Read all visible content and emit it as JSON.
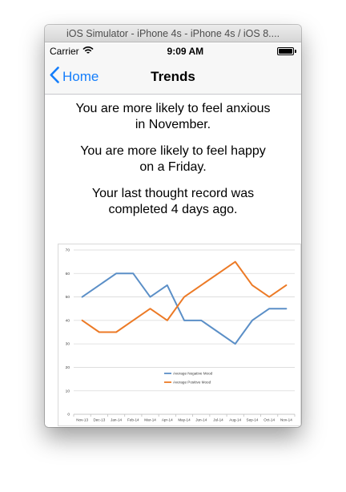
{
  "window": {
    "title": "iOS Simulator - iPhone 4s - iPhone 4s / iOS 8...."
  },
  "status_bar": {
    "carrier": "Carrier",
    "time": "9:09 AM"
  },
  "nav": {
    "back_label": "Home",
    "title": "Trends"
  },
  "messages": [
    "You are more likely to feel anxious in November.",
    "You are more likely to feel happy on a Friday.",
    "Your last thought record was completed 4 days ago."
  ],
  "colors": {
    "ios_blue": "#157efb",
    "negative_series": "#5b8fc7",
    "positive_series": "#ec7a26"
  },
  "chart_data": {
    "type": "line",
    "categories": [
      "Nov-13",
      "Dec-13",
      "Jan-14",
      "Feb-14",
      "Mar-14",
      "Apr-14",
      "May-14",
      "Jun-14",
      "Jul-14",
      "Aug-14",
      "Sep-14",
      "Oct-14",
      "Nov-14"
    ],
    "series": [
      {
        "name": "Average Negative Mood",
        "values": [
          50,
          55,
          60,
          60,
          50,
          55,
          40,
          40,
          35,
          30,
          40,
          45,
          45
        ]
      },
      {
        "name": "Average Positive Mood",
        "values": [
          40,
          35,
          35,
          40,
          45,
          40,
          50,
          55,
          60,
          65,
          55,
          50,
          55
        ]
      }
    ],
    "yticks": [
      0,
      10,
      20,
      30,
      40,
      50,
      60,
      70
    ],
    "ylim": [
      0,
      70
    ],
    "grid": true,
    "legend": "center"
  }
}
